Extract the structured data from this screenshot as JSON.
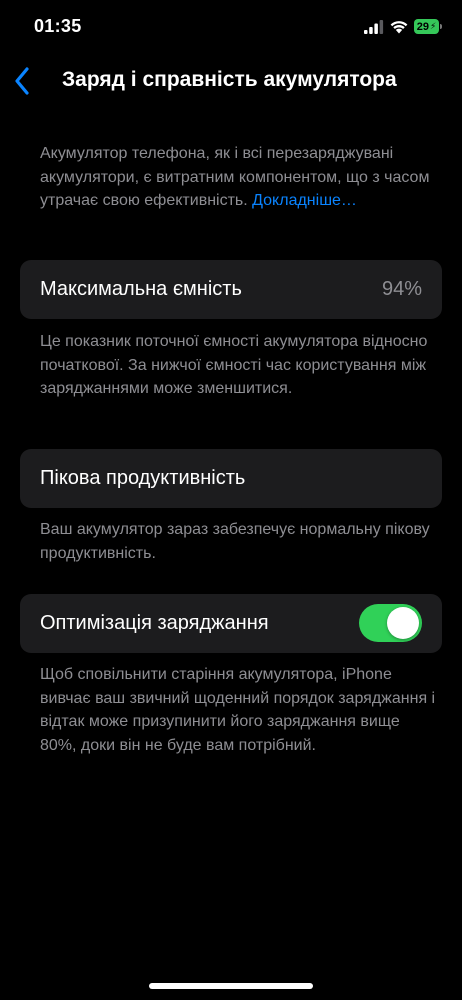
{
  "status_bar": {
    "time": "01:35",
    "battery_level": "29"
  },
  "header": {
    "title": "Заряд і справність акумулятора"
  },
  "intro": {
    "text": "Акумулятор телефона, як і всі перезаряджувані акумулятори, є витратним компонентом, що з часом утрачає свою ефективність. ",
    "link": "Докладніше…"
  },
  "max_capacity": {
    "label": "Максимальна ємність",
    "value": "94%",
    "footer": "Це показник поточної ємності акумулятора відносно початкової. За нижчої ємності час користування між заряджаннями може зменшитися."
  },
  "peak_performance": {
    "label": "Пікова продуктивність",
    "footer": "Ваш акумулятор зараз забезпечує нормальну пікову продуктивність."
  },
  "charging_optimization": {
    "label": "Оптимізація заряджання",
    "enabled": true,
    "footer": "Щоб сповільнити старіння акумулятора, iPhone вивчає ваш звичний щоденний порядок заряджання і відтак може призупинити його заряджання вище 80%, доки він не буде вам потрібний."
  },
  "colors": {
    "background": "#000000",
    "card": "#1c1c1e",
    "accent": "#0a84ff",
    "toggle_on": "#30d158",
    "secondary_text": "#8e8e93"
  }
}
